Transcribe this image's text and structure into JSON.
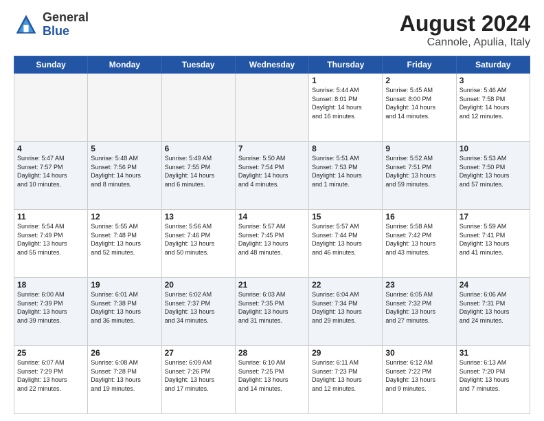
{
  "logo": {
    "general": "General",
    "blue": "Blue"
  },
  "title": "August 2024",
  "subtitle": "Cannole, Apulia, Italy",
  "weekdays": [
    "Sunday",
    "Monday",
    "Tuesday",
    "Wednesday",
    "Thursday",
    "Friday",
    "Saturday"
  ],
  "rows": [
    [
      {
        "day": "",
        "info": ""
      },
      {
        "day": "",
        "info": ""
      },
      {
        "day": "",
        "info": ""
      },
      {
        "day": "",
        "info": ""
      },
      {
        "day": "1",
        "info": "Sunrise: 5:44 AM\nSunset: 8:01 PM\nDaylight: 14 hours\nand 16 minutes."
      },
      {
        "day": "2",
        "info": "Sunrise: 5:45 AM\nSunset: 8:00 PM\nDaylight: 14 hours\nand 14 minutes."
      },
      {
        "day": "3",
        "info": "Sunrise: 5:46 AM\nSunset: 7:58 PM\nDaylight: 14 hours\nand 12 minutes."
      }
    ],
    [
      {
        "day": "4",
        "info": "Sunrise: 5:47 AM\nSunset: 7:57 PM\nDaylight: 14 hours\nand 10 minutes."
      },
      {
        "day": "5",
        "info": "Sunrise: 5:48 AM\nSunset: 7:56 PM\nDaylight: 14 hours\nand 8 minutes."
      },
      {
        "day": "6",
        "info": "Sunrise: 5:49 AM\nSunset: 7:55 PM\nDaylight: 14 hours\nand 6 minutes."
      },
      {
        "day": "7",
        "info": "Sunrise: 5:50 AM\nSunset: 7:54 PM\nDaylight: 14 hours\nand 4 minutes."
      },
      {
        "day": "8",
        "info": "Sunrise: 5:51 AM\nSunset: 7:53 PM\nDaylight: 14 hours\nand 1 minute."
      },
      {
        "day": "9",
        "info": "Sunrise: 5:52 AM\nSunset: 7:51 PM\nDaylight: 13 hours\nand 59 minutes."
      },
      {
        "day": "10",
        "info": "Sunrise: 5:53 AM\nSunset: 7:50 PM\nDaylight: 13 hours\nand 57 minutes."
      }
    ],
    [
      {
        "day": "11",
        "info": "Sunrise: 5:54 AM\nSunset: 7:49 PM\nDaylight: 13 hours\nand 55 minutes."
      },
      {
        "day": "12",
        "info": "Sunrise: 5:55 AM\nSunset: 7:48 PM\nDaylight: 13 hours\nand 52 minutes."
      },
      {
        "day": "13",
        "info": "Sunrise: 5:56 AM\nSunset: 7:46 PM\nDaylight: 13 hours\nand 50 minutes."
      },
      {
        "day": "14",
        "info": "Sunrise: 5:57 AM\nSunset: 7:45 PM\nDaylight: 13 hours\nand 48 minutes."
      },
      {
        "day": "15",
        "info": "Sunrise: 5:57 AM\nSunset: 7:44 PM\nDaylight: 13 hours\nand 46 minutes."
      },
      {
        "day": "16",
        "info": "Sunrise: 5:58 AM\nSunset: 7:42 PM\nDaylight: 13 hours\nand 43 minutes."
      },
      {
        "day": "17",
        "info": "Sunrise: 5:59 AM\nSunset: 7:41 PM\nDaylight: 13 hours\nand 41 minutes."
      }
    ],
    [
      {
        "day": "18",
        "info": "Sunrise: 6:00 AM\nSunset: 7:39 PM\nDaylight: 13 hours\nand 39 minutes."
      },
      {
        "day": "19",
        "info": "Sunrise: 6:01 AM\nSunset: 7:38 PM\nDaylight: 13 hours\nand 36 minutes."
      },
      {
        "day": "20",
        "info": "Sunrise: 6:02 AM\nSunset: 7:37 PM\nDaylight: 13 hours\nand 34 minutes."
      },
      {
        "day": "21",
        "info": "Sunrise: 6:03 AM\nSunset: 7:35 PM\nDaylight: 13 hours\nand 31 minutes."
      },
      {
        "day": "22",
        "info": "Sunrise: 6:04 AM\nSunset: 7:34 PM\nDaylight: 13 hours\nand 29 minutes."
      },
      {
        "day": "23",
        "info": "Sunrise: 6:05 AM\nSunset: 7:32 PM\nDaylight: 13 hours\nand 27 minutes."
      },
      {
        "day": "24",
        "info": "Sunrise: 6:06 AM\nSunset: 7:31 PM\nDaylight: 13 hours\nand 24 minutes."
      }
    ],
    [
      {
        "day": "25",
        "info": "Sunrise: 6:07 AM\nSunset: 7:29 PM\nDaylight: 13 hours\nand 22 minutes."
      },
      {
        "day": "26",
        "info": "Sunrise: 6:08 AM\nSunset: 7:28 PM\nDaylight: 13 hours\nand 19 minutes."
      },
      {
        "day": "27",
        "info": "Sunrise: 6:09 AM\nSunset: 7:26 PM\nDaylight: 13 hours\nand 17 minutes."
      },
      {
        "day": "28",
        "info": "Sunrise: 6:10 AM\nSunset: 7:25 PM\nDaylight: 13 hours\nand 14 minutes."
      },
      {
        "day": "29",
        "info": "Sunrise: 6:11 AM\nSunset: 7:23 PM\nDaylight: 13 hours\nand 12 minutes."
      },
      {
        "day": "30",
        "info": "Sunrise: 6:12 AM\nSunset: 7:22 PM\nDaylight: 13 hours\nand 9 minutes."
      },
      {
        "day": "31",
        "info": "Sunrise: 6:13 AM\nSunset: 7:20 PM\nDaylight: 13 hours\nand 7 minutes."
      }
    ]
  ]
}
